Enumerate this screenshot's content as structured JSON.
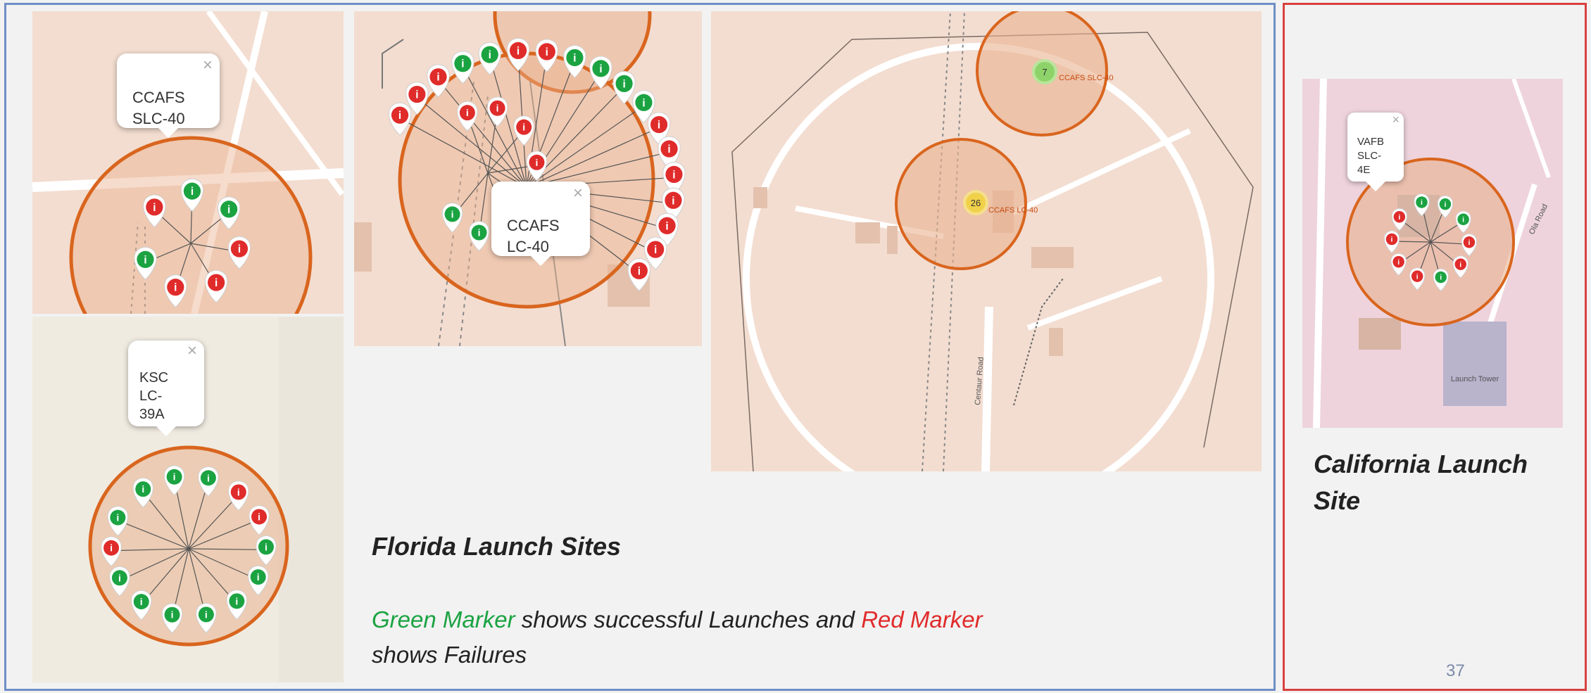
{
  "florida": {
    "title": "Florida Launch Sites",
    "legend_green": "Green Marker",
    "legend_middle": " shows successful Launches and ",
    "legend_red": "Red Marker",
    "legend_end": "shows Failures"
  },
  "california": {
    "title_line1": "California Launch",
    "title_line2": "Site",
    "page_number": "37"
  },
  "popups": {
    "ccafs_slc40": "CCAFS\nSLC-40",
    "ksc_lc39a": "KSC\nLC-\n39A",
    "ccafs_lc40": "CCAFS\nLC-40",
    "vafb_slc4e": "VAFB\nSLC-\n4E",
    "close": "×"
  },
  "map_labels": {
    "cluster_green_count": "7",
    "cluster_yellow_count": "26",
    "site_label_1": "CCAFS SLC-40",
    "site_label_2": "CCAFS LC-40",
    "road_centaur": "Centaur Road",
    "road_ola": "Ola Road",
    "launch_tower": "Launch Tower",
    "ksc_label": "KSC"
  },
  "colors": {
    "success": "#1ba342",
    "failure": "#e02b2b",
    "circle": "#d9651e",
    "map_bg": "#f3ddd0",
    "road": "#ffffff"
  },
  "markers": {
    "ccafs_slc40": [
      "failure",
      "success",
      "success",
      "failure",
      "failure",
      "failure",
      "success"
    ],
    "ksc_lc39a": [
      "success",
      "success",
      "success",
      "failure",
      "failure",
      "success",
      "success",
      "success",
      "success",
      "success",
      "success",
      "success",
      "failure",
      "success"
    ],
    "ccafs_lc40": [
      "failure",
      "failure",
      "failure",
      "success",
      "success",
      "failure",
      "failure",
      "success",
      "success",
      "success",
      "success",
      "failure",
      "failure",
      "failure",
      "failure",
      "failure",
      "failure",
      "failure",
      "failure",
      "failure",
      "failure",
      "failure",
      "failure",
      "failure",
      "success",
      "success"
    ],
    "vafb_slc4e": [
      "success",
      "success",
      "success",
      "failure",
      "failure",
      "success",
      "failure",
      "failure",
      "failure",
      "failure"
    ]
  }
}
